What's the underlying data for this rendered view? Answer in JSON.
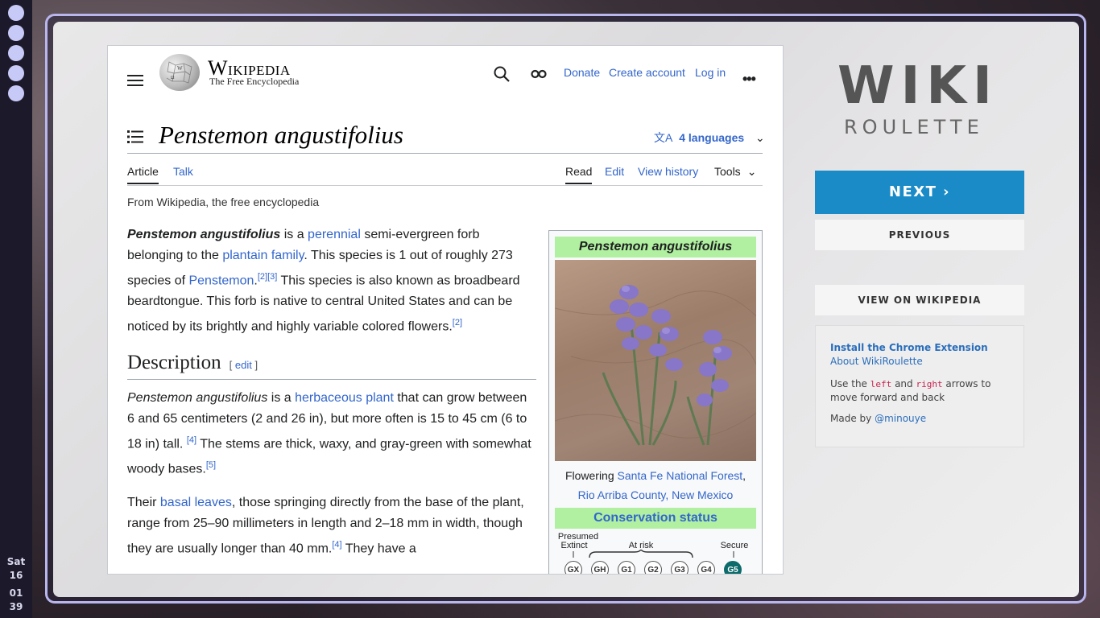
{
  "dock": {
    "workspaces": 5,
    "day": "Sat",
    "date": "16",
    "hour": "01",
    "minute": "39"
  },
  "wiki": {
    "wordmark": "Wikipedia",
    "tagline": "The Free Encyclopedia",
    "header_links": [
      "Donate",
      "Create account",
      "Log in"
    ],
    "title": "Penstemon angustifolius",
    "languages": "4 languages",
    "tabs_left": [
      "Article",
      "Talk"
    ],
    "tabs_right": [
      "Read",
      "Edit",
      "View history",
      "Tools"
    ],
    "from": "From Wikipedia, the free encyclopedia",
    "intro": {
      "bold": "Penstemon angustifolius",
      "t1": " is a ",
      "l1": "perennial",
      "t2": " semi-evergreen forb belonging to the ",
      "l2": "plantain family",
      "t3": ". This species is 1 out of roughly 273 species of ",
      "l3": "Penstemon",
      "t4": ".",
      "r1": "[2][3]",
      "t5": " This species is also known as broadbeard beardtongue. This forb is native to central United States and can be noticed by its brightly and highly variable colored flowers.",
      "r2": "[2]"
    },
    "section": {
      "heading": "Description",
      "edit_open": "[ ",
      "edit": "edit",
      "edit_close": " ]"
    },
    "desc1": {
      "it": "Penstemon angustifolius",
      "t1": " is a ",
      "l1": "herbaceous plant",
      "t2": " that can grow between 6 and 65 centimeters (2 and 26 in), but more often is 15 to 45 cm (6 to 18 in) tall. ",
      "r1": "[4]",
      "t3": " The stems are thick, waxy, and gray-green with somewhat woody bases.",
      "r2": "[5]"
    },
    "desc2": {
      "t1": "Their ",
      "l1": "basal leaves",
      "t2": ", those springing directly from the base of the plant, range from 25–90 millimeters in length and 2–18 mm in width, though they are usually longer than 40 mm.",
      "r1": "[4]",
      "t3": " They have a"
    },
    "infobox": {
      "title": "Penstemon angustifolius",
      "caption_pre": "Flowering ",
      "caption_l1": "Santa Fe National Forest",
      "caption_mid": ",",
      "caption_l2": "Rio Arriba County, New Mexico",
      "conservation": "Conservation status",
      "lbl_presumed": "Presumed",
      "lbl_extinct": "Extinct",
      "lbl_atrisk": "At risk",
      "lbl_secure": "Secure",
      "ranks": [
        "GX",
        "GH",
        "G1",
        "G2",
        "G3",
        "G4",
        "G5"
      ],
      "selected_rank": "G5"
    }
  },
  "roulette": {
    "logo_top": "WIKI",
    "logo_bottom": "ROULETTE",
    "next": "NEXT ›",
    "previous": "PREVIOUS",
    "view": "VIEW ON WIKIPEDIA",
    "install": "Install the Chrome Extension",
    "about": "About WikiRoulette",
    "use_pre": "Use the ",
    "key_left": "left",
    "use_and": " and ",
    "key_right": "right",
    "use_post": " arrows to move forward and back",
    "made_by": "Made by ",
    "author": "@minouye"
  },
  "colors": {
    "accent": "#1a8bc7",
    "infobox_header": "#b0f0a0",
    "link": "#3366cc",
    "rank_selected": "#0d6b6b"
  }
}
